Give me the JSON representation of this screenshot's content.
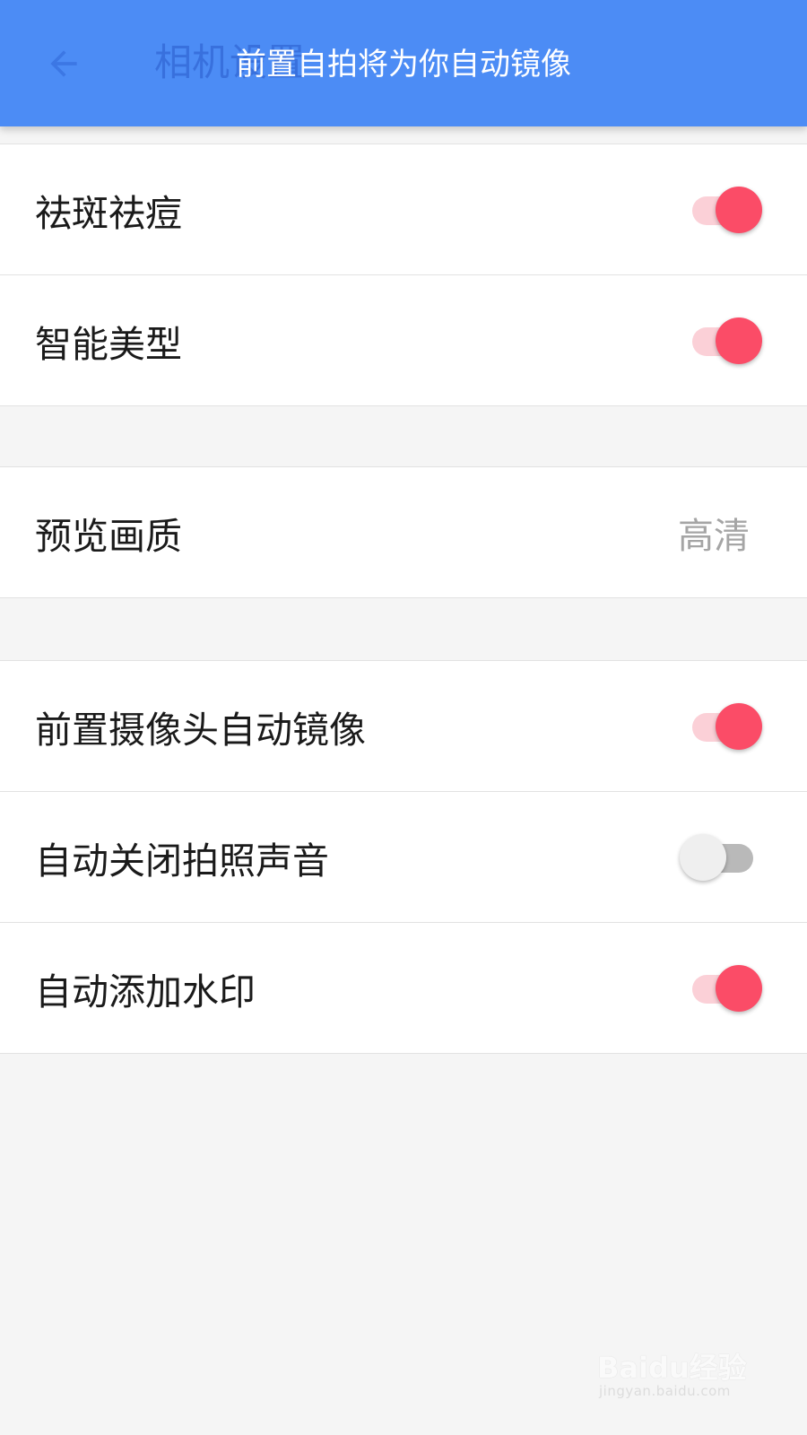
{
  "header": {
    "title": "相机设置",
    "back_icon": "arrow-left-icon",
    "background_color": "#4c8cf5"
  },
  "toast": {
    "message": "前置自拍将为你自动镜像"
  },
  "groups": [
    {
      "rows": [
        {
          "label": "祛斑祛痘",
          "control": "switch",
          "on": true
        },
        {
          "label": "智能美型",
          "control": "switch",
          "on": true
        }
      ]
    },
    {
      "rows": [
        {
          "label": "预览画质",
          "control": "value",
          "value": "高清"
        }
      ]
    },
    {
      "rows": [
        {
          "label": "前置摄像头自动镜像",
          "control": "switch",
          "on": true
        },
        {
          "label": "自动关闭拍照声音",
          "control": "switch",
          "on": false
        },
        {
          "label": "自动添加水印",
          "control": "switch",
          "on": true
        }
      ]
    }
  ],
  "colors": {
    "switch_on_thumb": "#fb4c67",
    "switch_on_track": "#fbd0d7",
    "switch_off_thumb": "#efefef",
    "switch_off_track": "#b9b9b9",
    "value_text": "#a5a5a5"
  },
  "watermark": {
    "main": "Baidu经验",
    "sub": "jingyan.baidu.com"
  }
}
